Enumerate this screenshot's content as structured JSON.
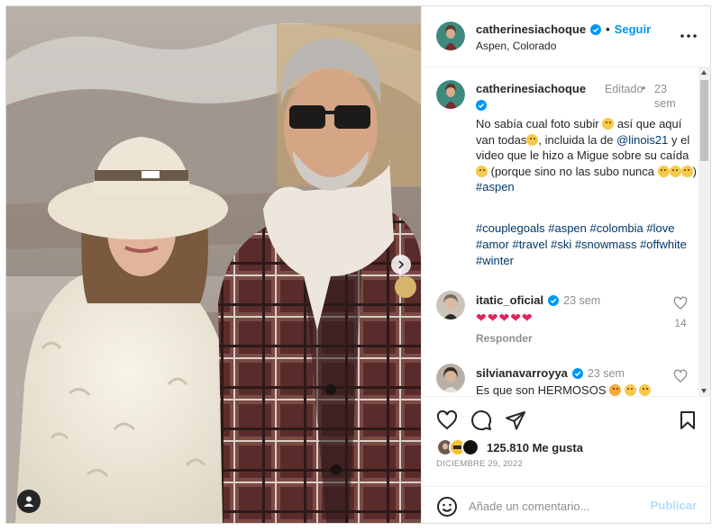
{
  "post": {
    "username": "catherinesiachoque",
    "follow_label": "Seguir",
    "location": "Aspen, Colorado",
    "dot": "•"
  },
  "caption": {
    "username": "catherinesiachoque",
    "edited": "Editado",
    "sep": "•",
    "time": "23 sem",
    "text_1": "No sabía cual foto subir ",
    "text_2": " así que aquí van todas",
    "text_3": ", incluida la de ",
    "mention": "@linois21",
    "text_4": " y el video que le hizo a Migue sobre su caída ",
    "text_5": " (porque sino no las subo nunca ",
    "text_6": ") ",
    "hashtag_inline": "#aspen",
    "hashtags": "#couplegoals #aspen #colombia #love #amor #travel #ski #snowmass #offwhite #winter"
  },
  "comments": [
    {
      "username": "itatic_oficial",
      "time": "23 sem",
      "text": "❤❤❤❤❤",
      "reply_label": "Responder",
      "likes": "14"
    },
    {
      "username": "silvianavarroyya",
      "time": "23 sem",
      "text": "Es que son HERMOSOS ",
      "likes": ""
    }
  ],
  "actions": {
    "likes_count": "125.810 Me gusta",
    "date": "DICIEMBRE 29, 2022"
  },
  "add_comment": {
    "placeholder": "Añade un comentario...",
    "publish_label": "Publicar"
  },
  "colors": {
    "link": "#00376b",
    "accent": "#0095f6",
    "muted": "#8e8e8e",
    "publish_disabled": "#b3dbff"
  },
  "icons": [
    "verified-icon",
    "more-options-icon",
    "heart-icon",
    "comment-icon",
    "share-icon",
    "save-icon",
    "emoji-icon",
    "carousel-next-icon",
    "user-tag-icon"
  ]
}
